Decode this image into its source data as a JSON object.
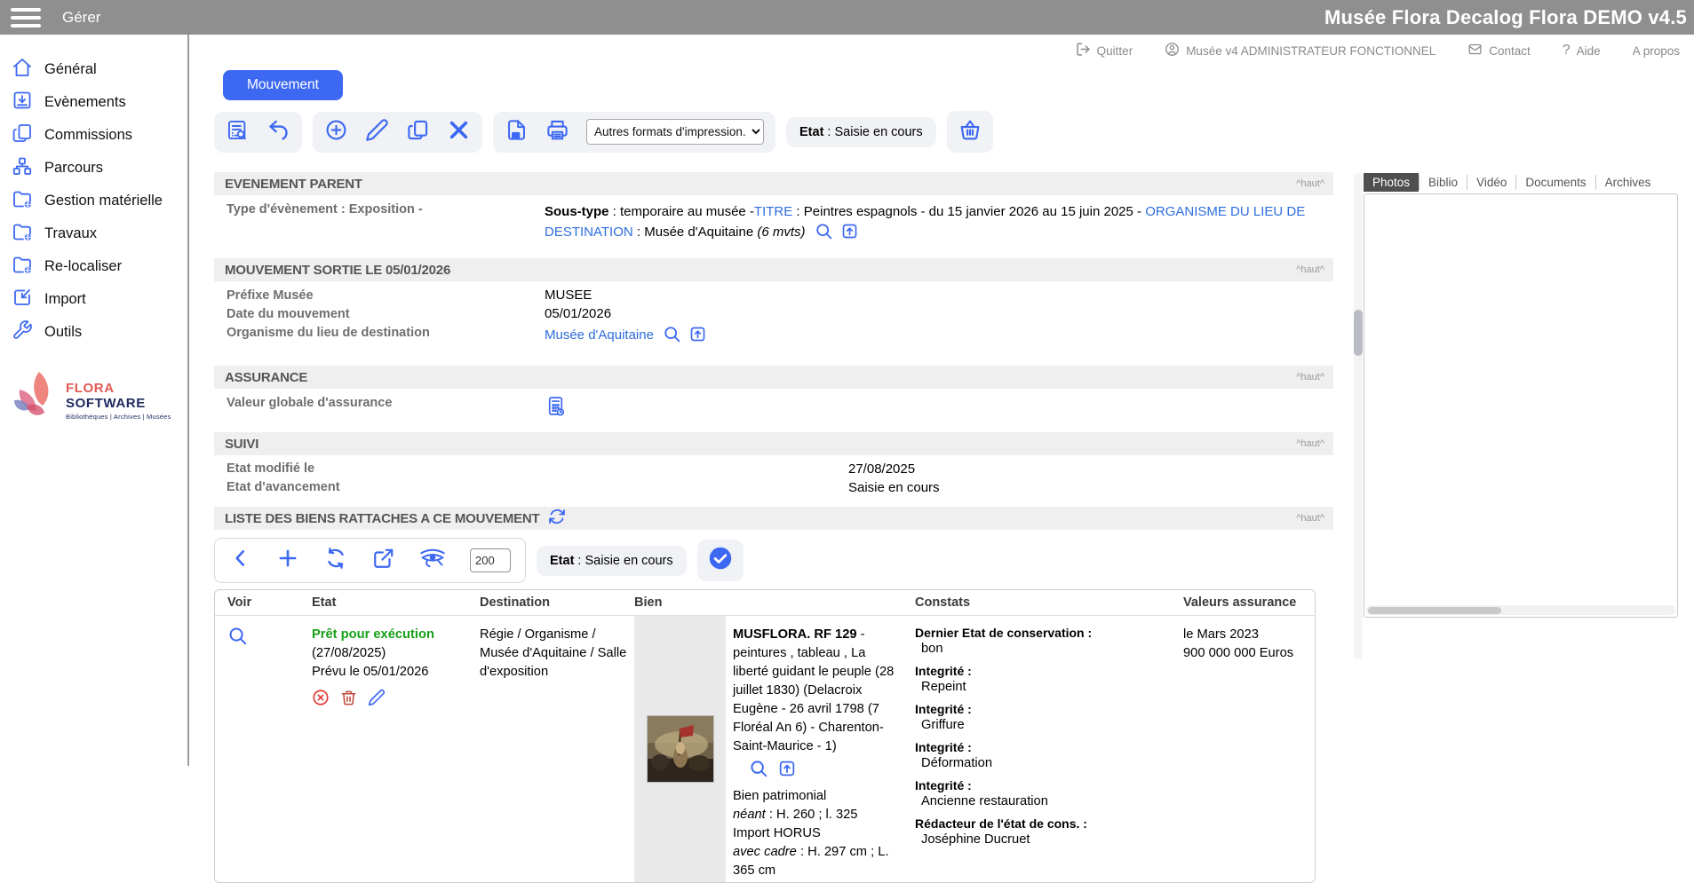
{
  "colors": {
    "accent": "#3c68f2",
    "link": "#2e6ddd",
    "topbar": "#8f8f8f",
    "status_green": "#16a016",
    "alert_red": "#e23b36",
    "trash_red": "#c2493f",
    "section_bg": "#efefef"
  },
  "icons": [
    "hamburger-menu",
    "home",
    "inbox-event",
    "copy-pages",
    "sitemap",
    "folder-globe",
    "import-arrow",
    "wrench",
    "logout",
    "user-circle",
    "envelope",
    "question-mark",
    "form-search",
    "undo",
    "plus-circle",
    "pencil",
    "copy",
    "delete-x",
    "file-print",
    "printer",
    "basket",
    "magnifier",
    "open-record",
    "calculator",
    "refresh",
    "chevron-left",
    "plus",
    "recycle",
    "external-link",
    "eye-of-horus",
    "check-circle",
    "cancel-circle",
    "trash",
    "flora-flower",
    "painting-thumbnail"
  ],
  "topbar": {
    "menu_label": "Gérer",
    "app_title": "Musée Flora Decalog Flora DEMO v4.5"
  },
  "header": {
    "links": [
      {
        "label": "Quitter"
      },
      {
        "label": "Musée v4 ADMINISTRATEUR FONCTIONNEL"
      },
      {
        "label": "Contact"
      },
      {
        "label": "Aide"
      },
      {
        "label": "A propos"
      }
    ]
  },
  "sidebar": {
    "items": [
      {
        "label": "Général"
      },
      {
        "label": "Evènements"
      },
      {
        "label": "Commissions"
      },
      {
        "label": "Parcours"
      },
      {
        "label": "Gestion matérielle"
      },
      {
        "label": "Travaux"
      },
      {
        "label": "Re-localiser"
      },
      {
        "label": "Import"
      },
      {
        "label": "Outils"
      }
    ],
    "logo": {
      "brand_primary": "FLORA",
      "brand_secondary": "SOFTWARE",
      "tagline": "Bibliothèques | Archives | Musées"
    }
  },
  "main": {
    "tab_label": "Mouvement",
    "toolbar": {
      "print_dropdown": "Autres formats d'impression...",
      "etat_label": "Etat",
      "etat_sep": " : ",
      "etat_value": "Saisie en cours"
    },
    "sections": {
      "evenement_parent": {
        "title": "EVENEMENT PARENT",
        "top_link": "^haut^",
        "type_label": "Type d'évènement : Exposition -",
        "value": {
          "soustype_label": "Sous-type",
          "soustype_text": " : temporaire au musée -",
          "titre_link": "TITRE",
          "titre_text": " : Peintres espagnols - du 15 janvier 2026 au 15 juin 2025 - ",
          "organisme_link": "ORGANISME DU LIEU DE DESTINATION",
          "organisme_text": " : Musée d'Aquitaine ",
          "mvts": "(6 mvts)"
        }
      },
      "mouvement_sortie": {
        "title": "MOUVEMENT SORTIE LE 05/01/2026",
        "top_link": "^haut^",
        "rows": [
          {
            "label": "Préfixe Musée",
            "value": "MUSEE"
          },
          {
            "label": "Date du mouvement",
            "value": "05/01/2026"
          },
          {
            "label": "Organisme du lieu de destination",
            "value": "Musée d'Aquitaine"
          }
        ]
      },
      "assurance": {
        "title": "ASSURANCE",
        "top_link": "^haut^",
        "rows": [
          {
            "label": "Valeur globale d'assurance"
          }
        ]
      },
      "suivi": {
        "title": "SUIVI",
        "top_link": "^haut^",
        "rows": [
          {
            "label": "Etat modifié le",
            "value": "27/08/2025"
          },
          {
            "label": "Etat d'avancement",
            "value": "Saisie en cours"
          }
        ]
      },
      "liste": {
        "title": "LISTE DES BIENS RATTACHES A CE MOUVEMENT",
        "top_link": "^haut^",
        "toolbar": {
          "page_size": "200",
          "etat_label": "Etat",
          "etat_sep": " : ",
          "etat_value": "Saisie en cours"
        }
      }
    },
    "table": {
      "columns": [
        {
          "label": "Voir"
        },
        {
          "label": "Etat"
        },
        {
          "label": "Destination"
        },
        {
          "label": "Bien"
        },
        {
          "label": "Constats"
        },
        {
          "label": "Valeurs assurance"
        }
      ],
      "row": {
        "etat": {
          "status": "Prêt pour exécution",
          "status_date": "(27/08/2025)",
          "planned": "Prévu le  05/01/2026"
        },
        "destination": "Régie / Organisme / Musée d'Aquitaine / Salle d'exposition",
        "bien": {
          "ref": "MUSFLORA. RF 129",
          "desc": " - peintures , tableau , La liberté guidant le peuple (28 juillet 1830) (Delacroix Eugène - 26 avril 1798 (7 Floréal An 6) - Charenton-Saint-Maurice - 1)",
          "type": "Bien patrimonial",
          "dim1_label": "néant",
          "dim1_value": " : H. 260 ; l. 325",
          "import_line": "Import HORUS",
          "dim2_label": "avec cadre",
          "dim2_value": " : H. 297 cm ; L. 365 cm"
        },
        "constats": [
          {
            "label": "Dernier Etat de conservation :",
            "value": "bon"
          },
          {
            "label": "Integrité :",
            "value": "Repeint"
          },
          {
            "label": "Integrité :",
            "value": "Griffure"
          },
          {
            "label": "Integrité :",
            "value": "Déformation"
          },
          {
            "label": "Integrité :",
            "value": "Ancienne restauration"
          },
          {
            "label": "Rédacteur de l'état de cons. :",
            "value": "Joséphine Ducruet"
          }
        ],
        "valeurs": {
          "date": "le Mars 2023",
          "amount": "900 000 000 Euros"
        }
      }
    }
  },
  "right_panel": {
    "tabs": [
      {
        "label": "Photos"
      },
      {
        "label": "Biblio"
      },
      {
        "label": "Vidéo"
      },
      {
        "label": "Documents"
      },
      {
        "label": "Archives"
      }
    ]
  }
}
